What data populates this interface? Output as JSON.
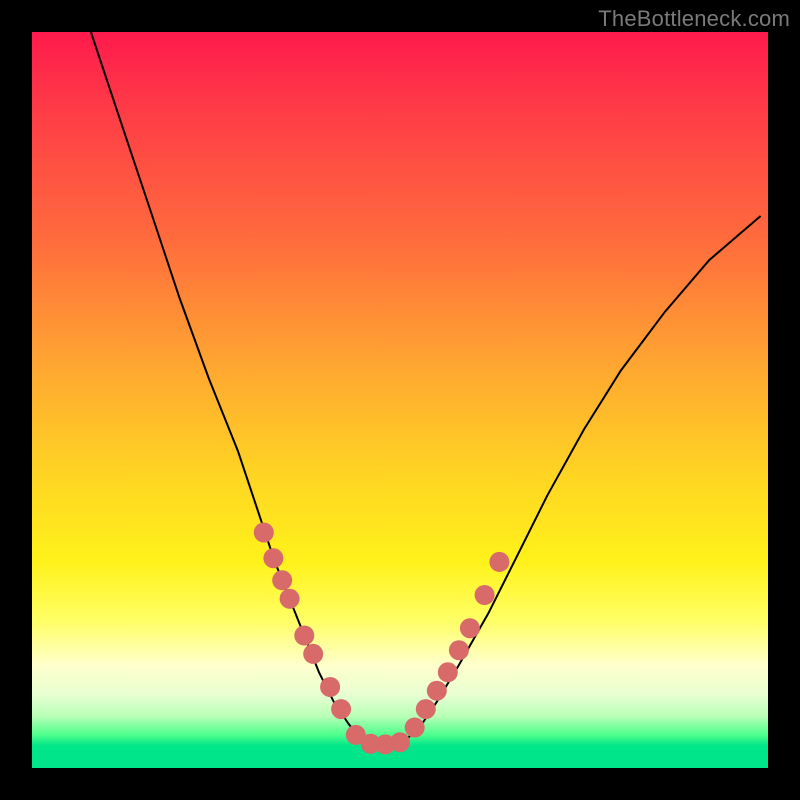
{
  "watermark": "TheBottleneck.com",
  "colors": {
    "frame": "#000000",
    "curve": "#000000",
    "marker": "#d86a6a",
    "gradient_top": "#ff1a4d",
    "gradient_mid": "#ffd423",
    "gradient_bottom": "#00e58a"
  },
  "chart_data": {
    "type": "line",
    "title": "",
    "xlabel": "",
    "ylabel": "",
    "xlim": [
      0,
      100
    ],
    "ylim": [
      0,
      100
    ],
    "note": "Axes are unlabeled; x/y expressed as percent of plot area (0,0 = bottom-left). Curve shows a bottleneck-style V with minimum near x≈45.",
    "series": [
      {
        "name": "bottleneck-curve",
        "x": [
          8,
          12,
          16,
          20,
          24,
          28,
          31,
          33,
          35,
          37,
          39,
          41,
          43,
          45,
          47,
          49,
          51,
          53,
          55,
          58,
          62,
          66,
          70,
          75,
          80,
          86,
          92,
          99
        ],
        "y": [
          100,
          88,
          76,
          64,
          53,
          43,
          34,
          28,
          23,
          18,
          13,
          9,
          6,
          3.5,
          3,
          3,
          4,
          6,
          9,
          14,
          21,
          29,
          37,
          46,
          54,
          62,
          69,
          75
        ]
      }
    ],
    "markers": {
      "name": "highlighted-points",
      "x": [
        31.5,
        32.8,
        34.0,
        35.0,
        37.0,
        38.2,
        40.5,
        42.0,
        44.0,
        46.0,
        48.0,
        50.0,
        52.0,
        53.5,
        55.0,
        56.5,
        58.0,
        59.5,
        61.5,
        63.5
      ],
      "y": [
        32.0,
        28.5,
        25.5,
        23.0,
        18.0,
        15.5,
        11.0,
        8.0,
        4.5,
        3.3,
        3.2,
        3.5,
        5.5,
        8.0,
        10.5,
        13.0,
        16.0,
        19.0,
        23.5,
        28.0
      ]
    }
  }
}
